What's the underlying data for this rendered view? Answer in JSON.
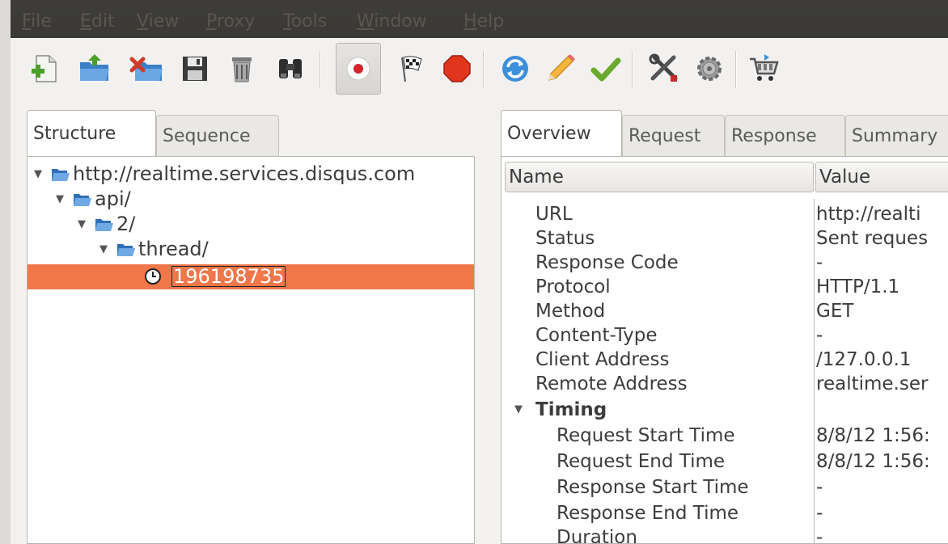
{
  "menu": [
    "File",
    "Edit",
    "View",
    "Proxy",
    "Tools",
    "Window",
    "Help"
  ],
  "toolbar": {
    "buttons": [
      {
        "name": "new-session-icon"
      },
      {
        "name": "open-session-icon"
      },
      {
        "name": "close-session-icon"
      },
      {
        "name": "save-icon"
      },
      {
        "name": "clear-icon"
      },
      {
        "name": "find-icon"
      },
      {
        "name": "record-icon"
      },
      {
        "name": "breakpoints-icon"
      },
      {
        "name": "stop-icon"
      },
      {
        "name": "repeat-icon"
      },
      {
        "name": "edit-icon"
      },
      {
        "name": "validate-icon"
      },
      {
        "name": "tools-icon"
      },
      {
        "name": "settings-icon"
      },
      {
        "name": "shop-icon"
      }
    ]
  },
  "left": {
    "tabs": [
      "Structure",
      "Sequence"
    ],
    "tree": [
      {
        "label": "http://realtime.services.disqus.com",
        "level": 0
      },
      {
        "label": "api/",
        "level": 1
      },
      {
        "label": "2/",
        "level": 2
      },
      {
        "label": "thread/",
        "level": 3
      },
      {
        "label": "196198735",
        "level": 4
      }
    ]
  },
  "right": {
    "tabs": [
      "Overview",
      "Request",
      "Response",
      "Summary"
    ],
    "columns": [
      "Name",
      "Value"
    ],
    "rows": [
      {
        "name": "URL",
        "value": "http://realti"
      },
      {
        "name": "Status",
        "value": "Sent reques"
      },
      {
        "name": "Response Code",
        "value": "-"
      },
      {
        "name": "Protocol",
        "value": "HTTP/1.1"
      },
      {
        "name": "Method",
        "value": "GET"
      },
      {
        "name": "Content-Type",
        "value": "-"
      },
      {
        "name": "Client Address",
        "value": "/127.0.0.1"
      },
      {
        "name": "Remote Address",
        "value": "realtime.ser"
      },
      {
        "name": "Timing",
        "value": ""
      },
      {
        "name": "Request Start Time",
        "value": "8/8/12 1:56:"
      },
      {
        "name": "Request End Time",
        "value": "8/8/12 1:56:"
      },
      {
        "name": "Response Start Time",
        "value": "-"
      },
      {
        "name": "Response End Time",
        "value": "-"
      },
      {
        "name": "Duration",
        "value": "-"
      }
    ]
  },
  "colors": {
    "selection": "#f0774a",
    "menubar": "#3c3b37",
    "menu_text": "#58564f"
  }
}
